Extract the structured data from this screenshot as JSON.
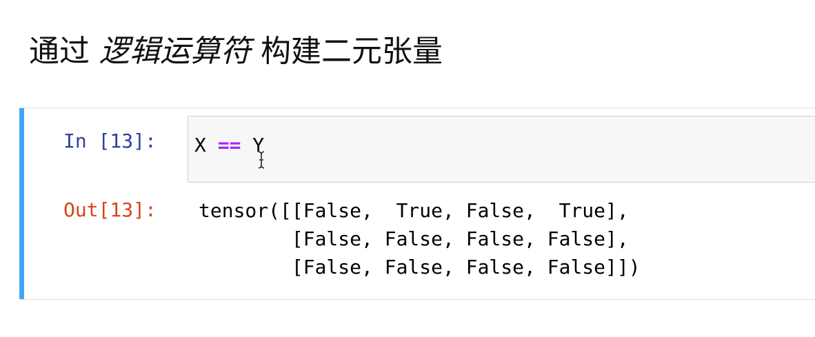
{
  "heading": {
    "prefix": "通过 ",
    "emphasis": "逻辑运算符",
    "suffix": " 构建二元张量"
  },
  "cell": {
    "input_prompt": "In [13]:",
    "output_prompt": "Out[13]:",
    "code": {
      "left": "X ",
      "operator": "==",
      "right": " Y"
    },
    "output_lines": [
      "tensor([[False,  True, False,  True],",
      "        [False, False, False, False],",
      "        [False, False, False, False]])"
    ]
  },
  "colors": {
    "cell_active_bar": "#42a5f5",
    "input_prompt": "#303f9f",
    "output_prompt": "#d84315",
    "operator": "#aa22ff",
    "input_background": "#f7f7f7"
  },
  "icons": {
    "mouse_cursor": "text-cursor-icon"
  }
}
